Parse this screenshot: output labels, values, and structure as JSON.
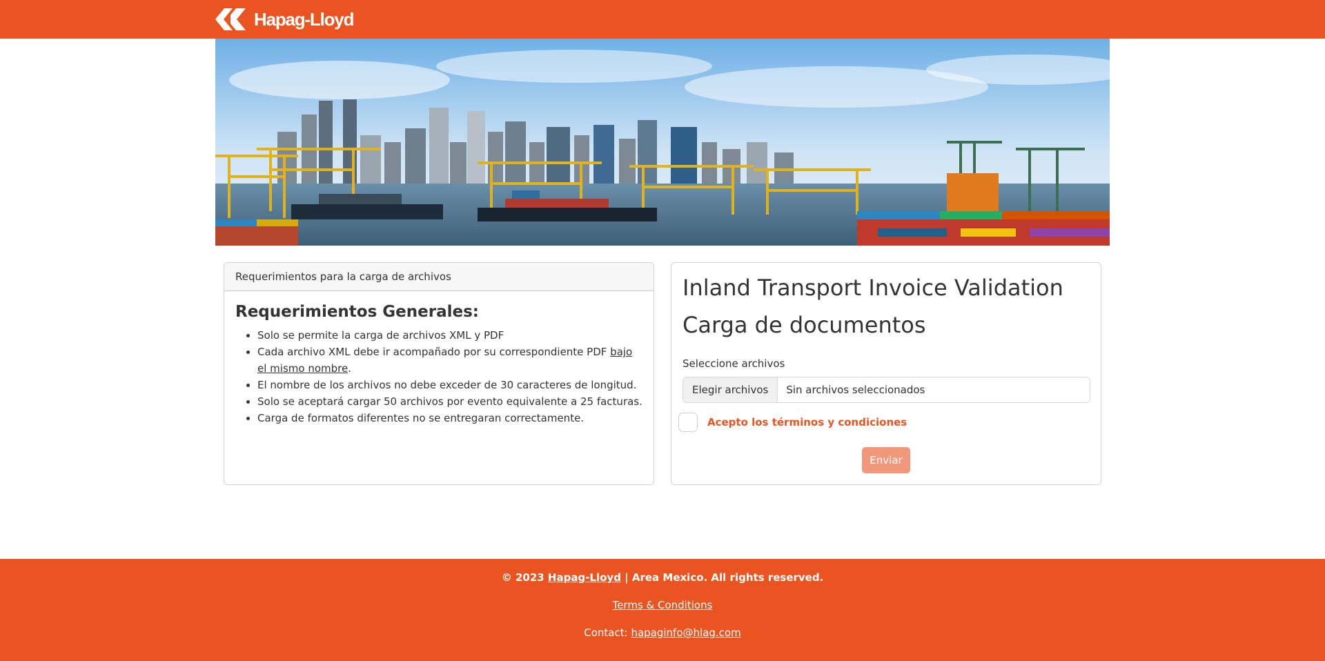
{
  "header": {
    "brand_name": "Hapag-Lloyd",
    "brand_color": "#e95420"
  },
  "hero": {
    "alt": ""
  },
  "requirements": {
    "card_header": "Requerimientos para la carga de archivos",
    "heading": "Requerimientos Generales:",
    "items": {
      "0": "Solo se permite la carga de archivos XML y PDF",
      "1_prefix": "Cada archivo XML debe ir acompañado por su correspondiente PDF ",
      "1_link": "bajo el mismo nombre",
      "1_suffix": ".",
      "2": "El nombre de los archivos no debe exceder de 30 caracteres de longitud.",
      "3": "Solo se aceptará cargar 50 archivos por evento equivalente a 25 facturas.",
      "4": "Carga de formatos diferentes no se entregaran correctamente."
    }
  },
  "upload": {
    "title": "Inland Transport Invoice Validation",
    "subtitle": "Carga de documentos",
    "select_label": "Seleccione archivos",
    "file_button": "Elegir archivos",
    "file_status": "Sin archivos seleccionados",
    "terms_label": "Acepto los términos y condiciones",
    "terms_checked": false,
    "submit_label": "Enviar",
    "accent_color": "#e95420"
  },
  "footer": {
    "copyright_prefix": "© 2023 ",
    "company_link": "Hapag-Lloyd",
    "copyright_suffix": " | Area Mexico. All rights reserved.",
    "terms_link": "Terms & Conditions",
    "contact_label": "Contact: ",
    "contact_email": "hapaginfo@hlag.com"
  }
}
